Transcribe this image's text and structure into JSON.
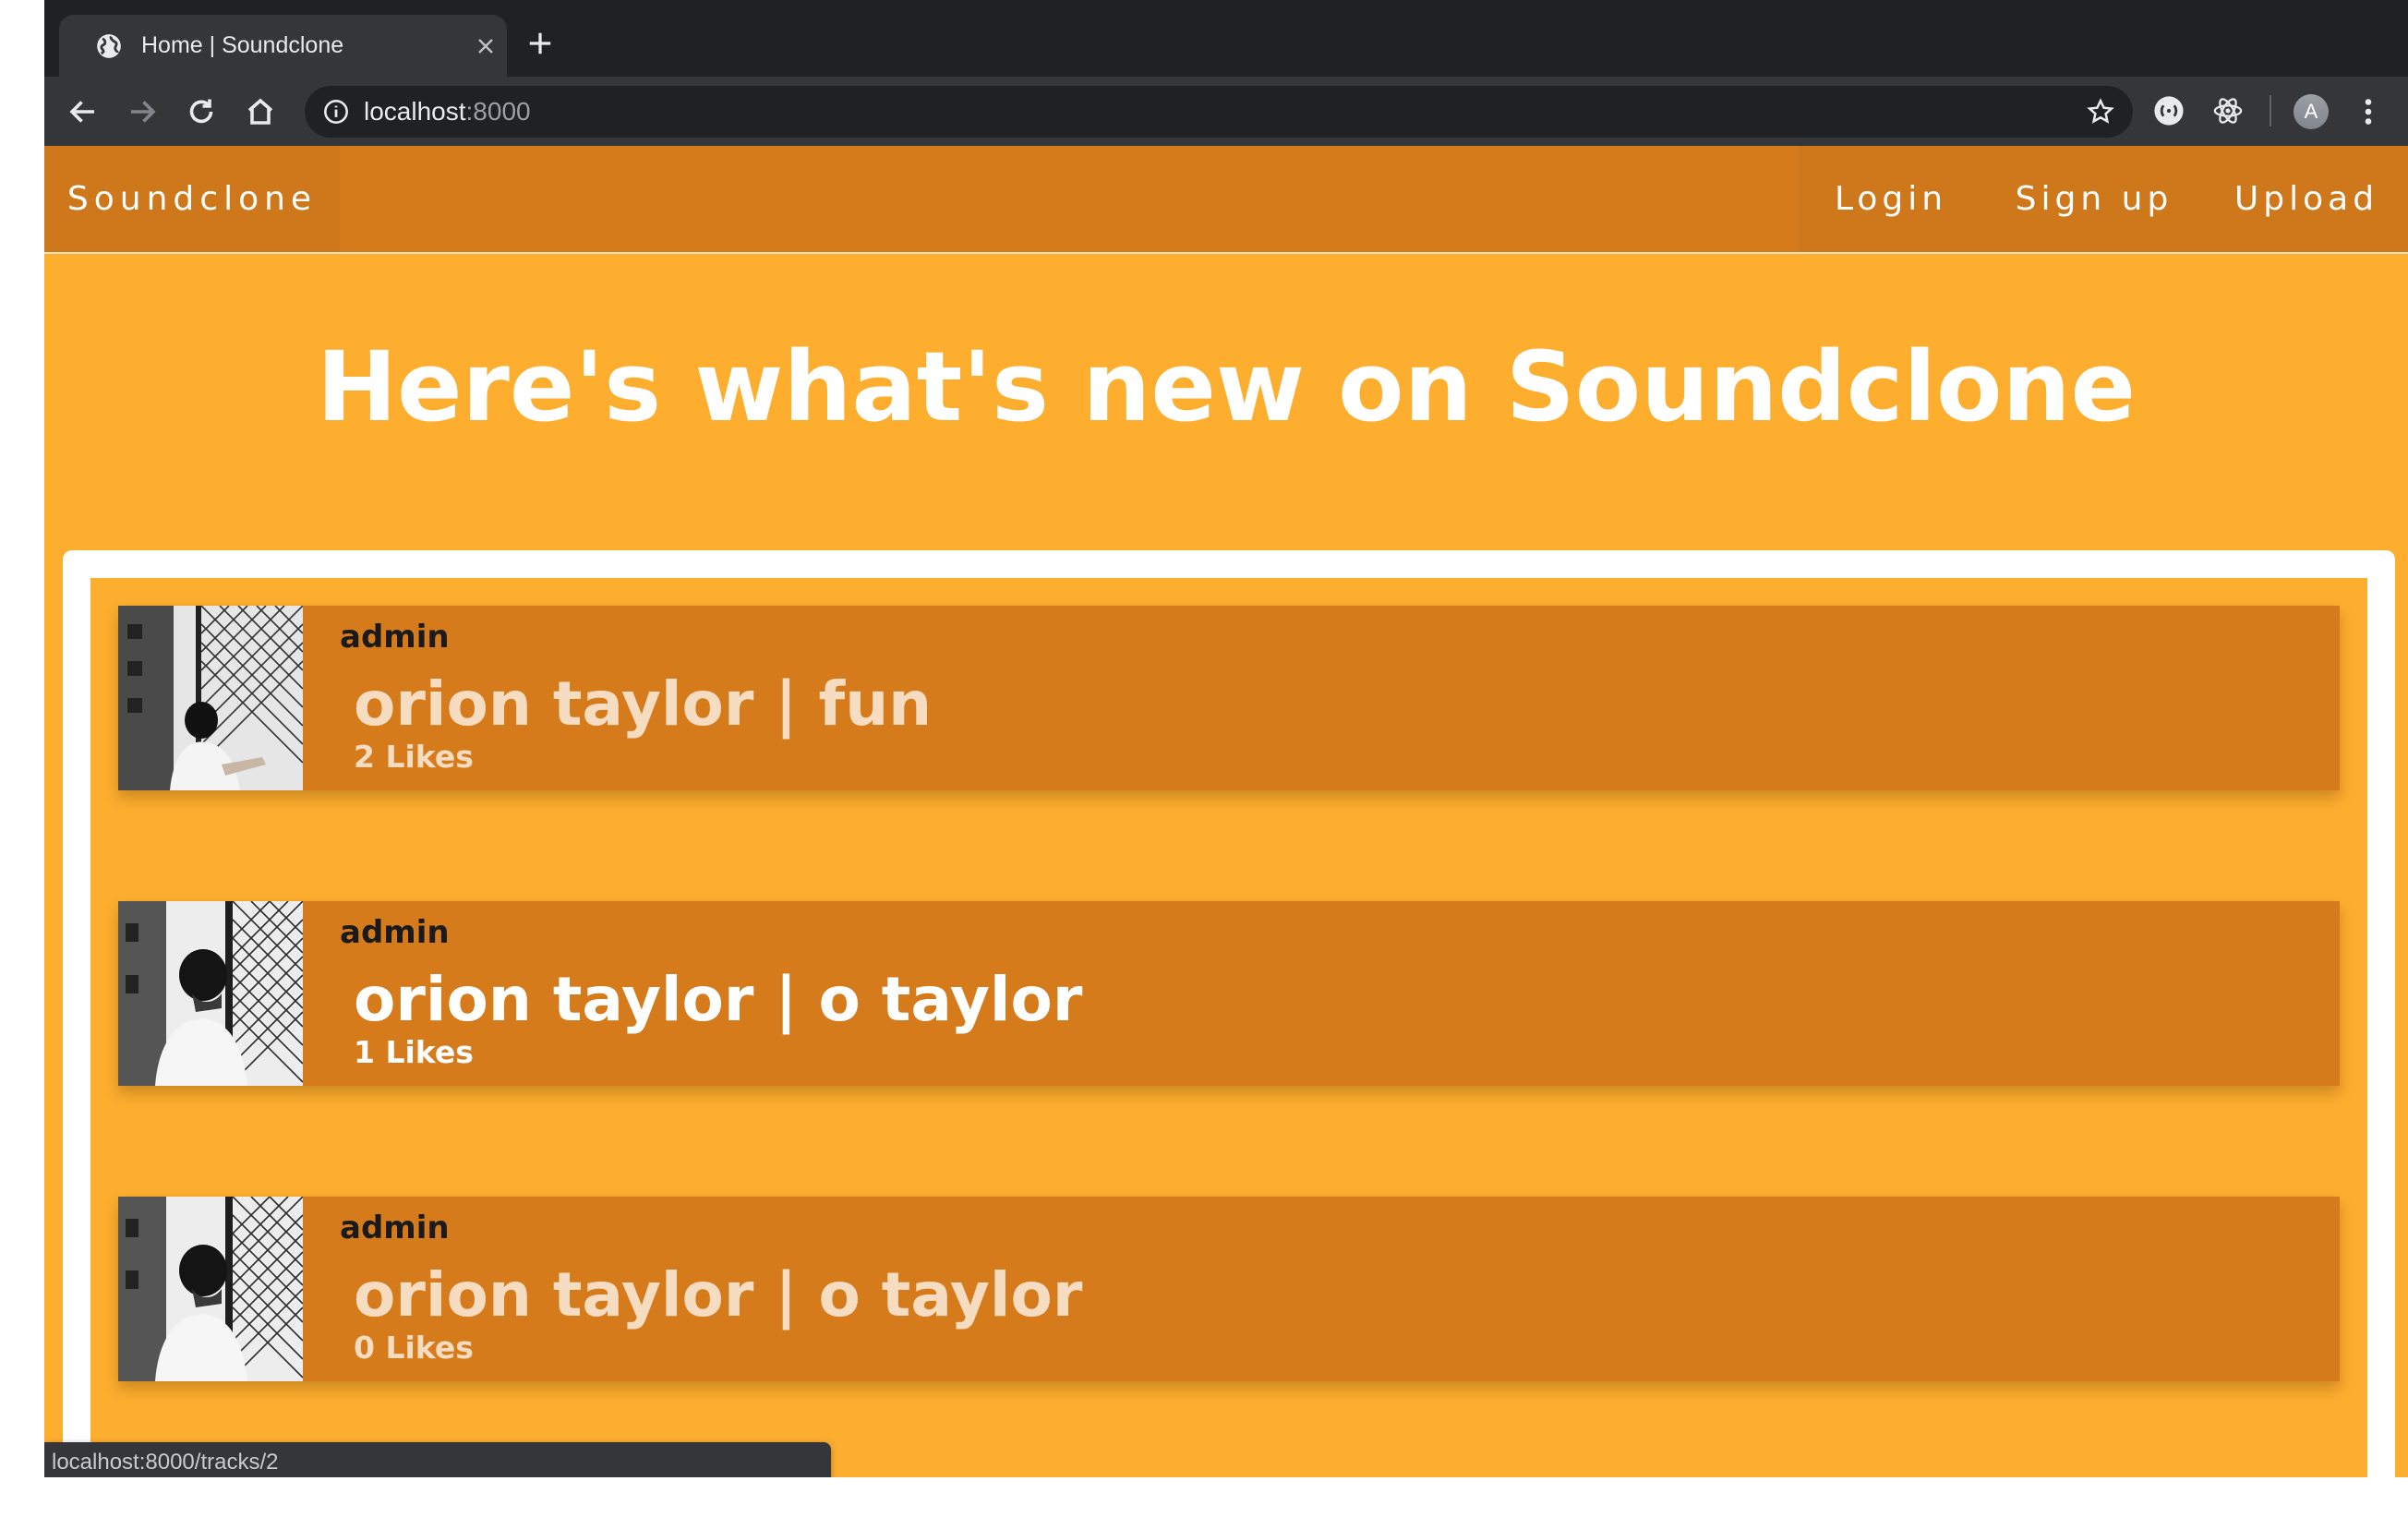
{
  "browser": {
    "tab_title": "Home | Soundclone",
    "url_host": "localhost",
    "url_port": ":8000",
    "profile_initial": "A",
    "status_url": "localhost:8000/tracks/2"
  },
  "navbar": {
    "brand": "Soundclone",
    "links": [
      "Login",
      "Sign up",
      "Upload"
    ]
  },
  "hero": {
    "heading": "Here's what's new on Soundclone"
  },
  "tracks": [
    {
      "user": "admin",
      "title": "orion taylor | fun",
      "likes": "2 Likes"
    },
    {
      "user": "admin",
      "title": "orion taylor | o taylor",
      "likes": "1 Likes"
    },
    {
      "user": "admin",
      "title": "orion taylor | o taylor",
      "likes": "0 Likes"
    }
  ],
  "colors": {
    "page_bg": "#fdae2f",
    "navbar_bg": "#d67b1c",
    "track_bg": "#d67b1c",
    "chrome_dark": "#202124",
    "chrome_toolbar": "#35363a"
  }
}
